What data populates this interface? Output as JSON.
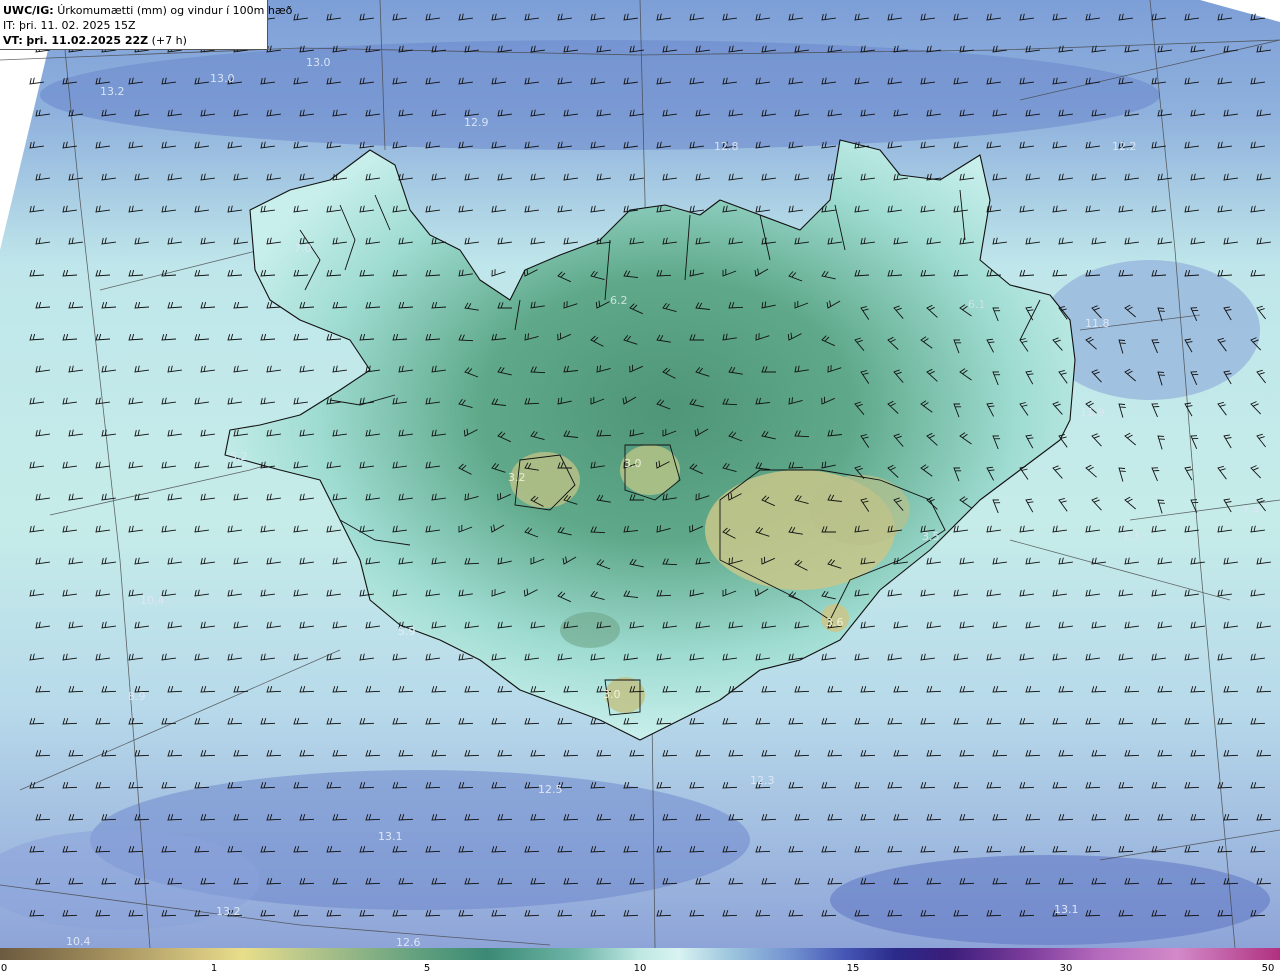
{
  "header": {
    "model": "UWC/IG:",
    "title": "Úrkomumætti (mm) og vindur í 100m hæð",
    "initial_time_prefix": "IT:",
    "initial_time": "þri. 11. 02. 2025 15Z",
    "valid_time_prefix": "VT:",
    "valid_time": "þri. 11.02.2025 22Z",
    "lead": "(+7 h)"
  },
  "colorbar": {
    "ticks": [
      "0",
      "1",
      "5",
      "10",
      "15",
      "30",
      "50"
    ],
    "colors": [
      "#6b5a3f",
      "#e8de8a",
      "#3b8a75",
      "#d8f3f1",
      "#2b2a8a",
      "#b66bbd",
      "#b0307f"
    ]
  },
  "map": {
    "labels": [
      "13.0",
      "13.2",
      "13.0",
      "12.9",
      "12.8",
      "12.2",
      "6.2",
      "6.1",
      "11.8",
      "7.0",
      "11.9",
      "5.2",
      "3.2",
      "3.0",
      "7.4",
      "7.3",
      "3.5",
      "10.4",
      "5.9",
      "8.9",
      "3.0",
      "3.6",
      "12.5",
      "12.3",
      "13.1",
      "13.2",
      "13.1",
      "10.4",
      "12.6"
    ]
  }
}
